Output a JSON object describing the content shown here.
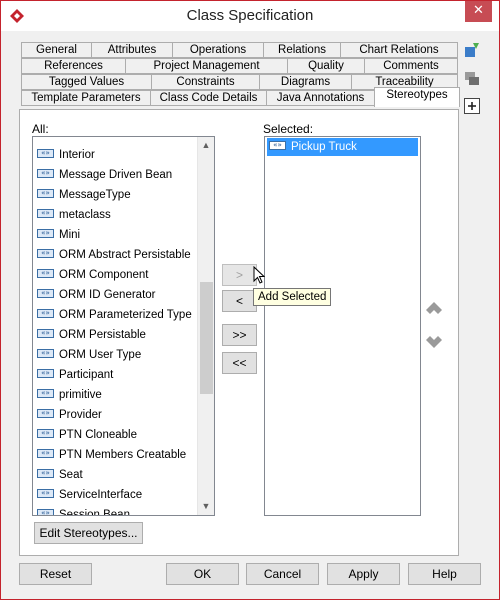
{
  "window": {
    "title": "Class Specification",
    "close_glyph": "✕"
  },
  "tabs": {
    "row1": [
      "General",
      "Attributes",
      "Operations",
      "Relations",
      "Chart Relations"
    ],
    "row2": [
      "References",
      "Project Management",
      "Quality",
      "Comments"
    ],
    "row3": [
      "Tagged Values",
      "Constraints",
      "Diagrams",
      "Traceability"
    ],
    "row4": [
      "Template Parameters",
      "Class Code Details",
      "Java Annotations",
      "Stereotypes"
    ],
    "active": "Stereotypes"
  },
  "all_list": {
    "label": "All:",
    "icon": "stereotype-icon",
    "icon_text": "«»",
    "items": [
      "Interior",
      "Message Driven Bean",
      "MessageType",
      "metaclass",
      "Mini",
      "ORM Abstract Persistable",
      "ORM Component",
      "ORM ID Generator",
      "ORM Parameterized Type",
      "ORM Persistable",
      "ORM User Type",
      "Participant",
      "primitive",
      "Provider",
      "PTN Cloneable",
      "PTN Members Creatable",
      "Seat",
      "ServiceInterface",
      "Session Bean"
    ]
  },
  "selected_list": {
    "label": "Selected:",
    "items": [
      "Pickup Truck"
    ]
  },
  "transfer_buttons": {
    "add": ">",
    "remove": "<",
    "add_all": ">>",
    "remove_all": "<<"
  },
  "tooltip": "Add Selected",
  "edit_button": "Edit Stereotypes...",
  "footer": {
    "reset": "Reset",
    "ok": "OK",
    "cancel": "Cancel",
    "apply": "Apply",
    "help": "Help"
  },
  "colors": {
    "selection": "#3399ff",
    "tooltip_bg": "#ffffe1",
    "window_border": "#c4232d",
    "close_button": "#c74c54"
  }
}
